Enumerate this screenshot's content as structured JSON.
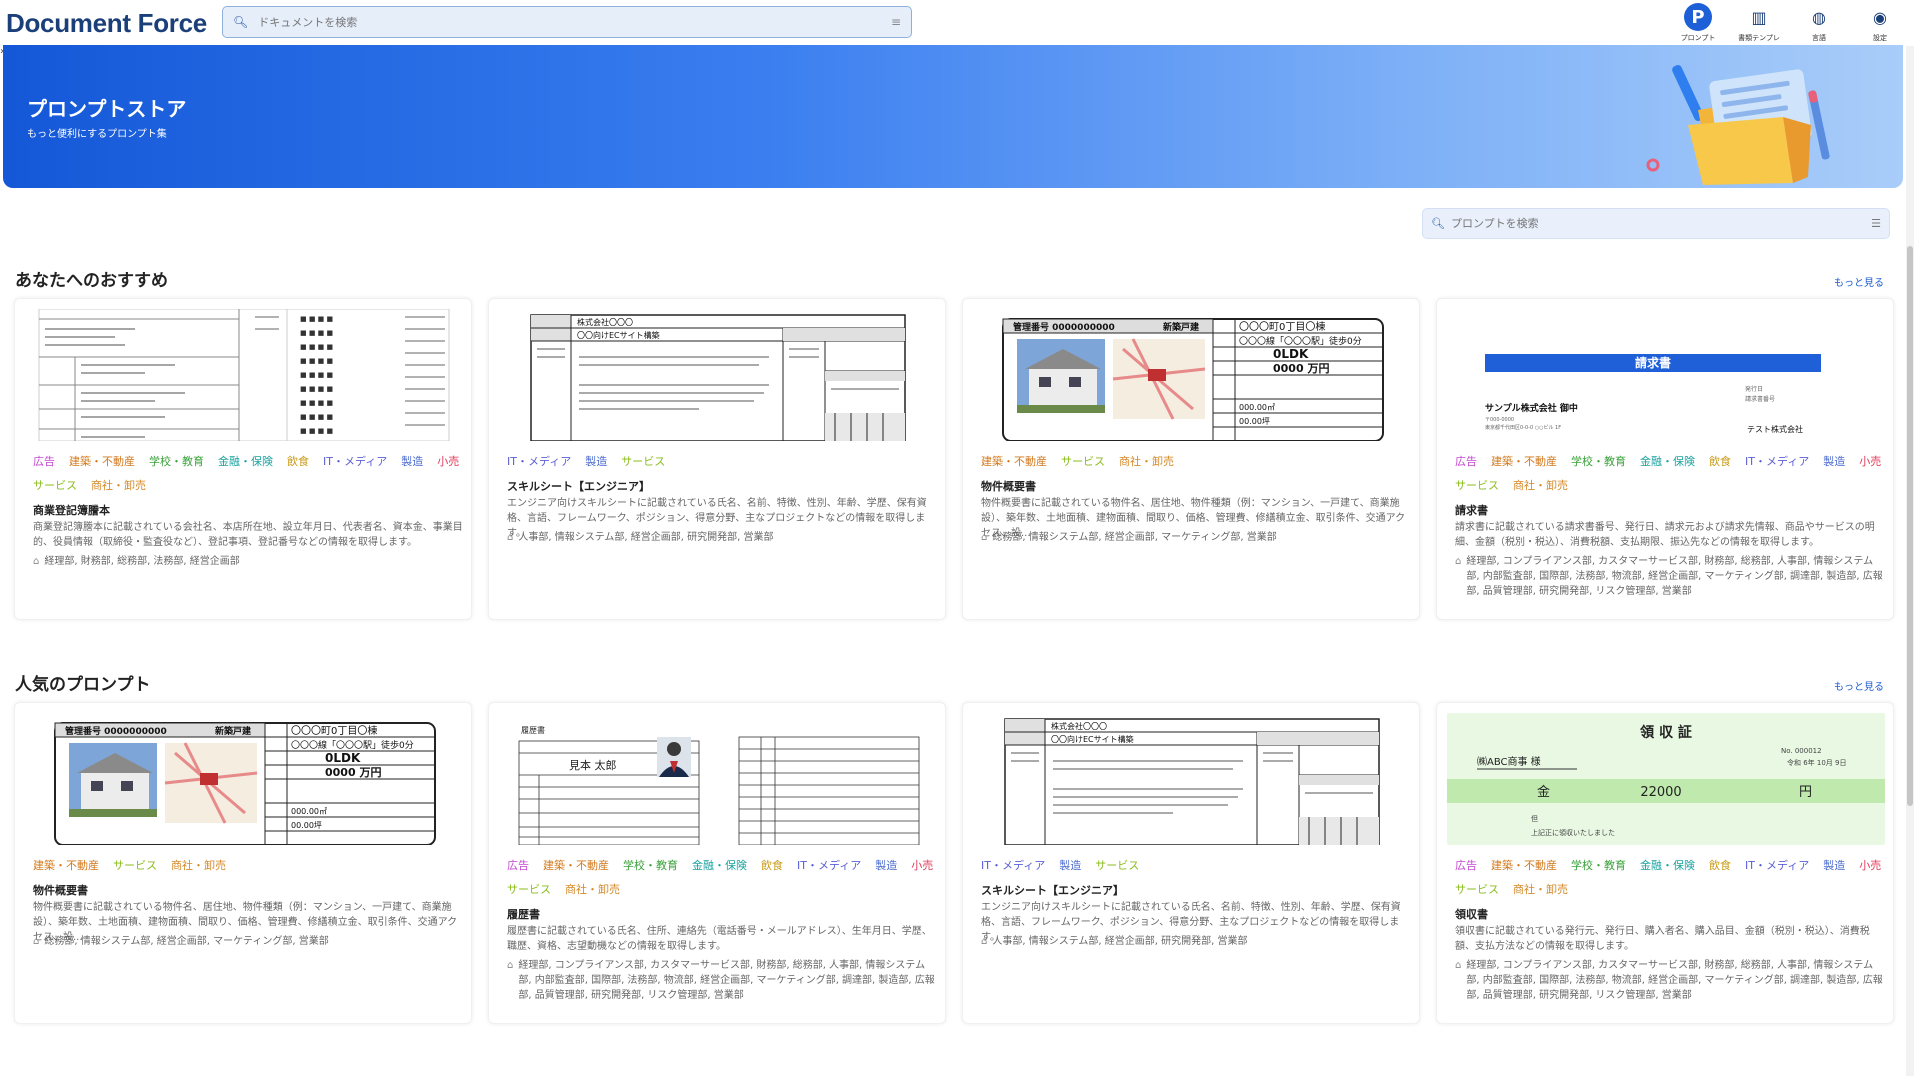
{
  "app": {
    "logo": "Document Force"
  },
  "header": {
    "search_placeholder": "ドキュメントを検索",
    "nav": [
      {
        "label": "プロンプト",
        "icon": "prompt-icon",
        "glyph": "P"
      },
      {
        "label": "書類テンプレ",
        "icon": "template-icon",
        "glyph": "▥"
      },
      {
        "label": "言語",
        "icon": "globe-icon",
        "glyph": "◍"
      },
      {
        "label": "設定",
        "icon": "user-settings-icon",
        "glyph": "◉"
      }
    ]
  },
  "banner": {
    "title": "プロンプトストア",
    "subtitle": "もっと便利にするプロンプト集"
  },
  "prompt_search": {
    "placeholder": "プロンプトを検索"
  },
  "sections": [
    {
      "title": "あなたへのおすすめ",
      "more": "もっと見る",
      "cards": [
        {
          "tags": [
            [
              "広告",
              "ad"
            ],
            [
              "建築・不動産",
              "re"
            ],
            [
              "学校・教育",
              "ed"
            ],
            [
              "金融・保険",
              "fi"
            ],
            [
              "飲食",
              "fd"
            ],
            [
              "IT・メディア",
              "it"
            ],
            [
              "製造",
              "mf"
            ],
            [
              "小売",
              "rt"
            ],
            [
              "サービス",
              "sv"
            ],
            [
              "商社・卸売",
              "tr"
            ]
          ],
          "title": "商業登記簿謄本",
          "desc": "商業登記簿謄本に記載されている会社名、本店所在地、設立年月日、代表者名、資本金、事業目的、役員情報（取締役・監査役など）、登記事項、登記番号などの情報を取得します。",
          "depts": "経理部, 財務部, 総務部, 法務部, 経営企画部"
        },
        {
          "tags": [
            [
              "IT・メディア",
              "it"
            ],
            [
              "製造",
              "mf"
            ],
            [
              "サービス",
              "sv"
            ]
          ],
          "title": "スキルシート【エンジニア】",
          "desc": "エンジニア向けスキルシートに記載されている氏名、名前、特徴、性別、年齢、学歴、保有資格、言語、フレームワーク、ポジション、得意分野、主なプロジェクトなどの情報を取得します。",
          "depts": "人事部, 情報システム部, 経営企画部, 研究開発部, 営業部"
        },
        {
          "tags": [
            [
              "建築・不動産",
              "re"
            ],
            [
              "サービス",
              "sv"
            ],
            [
              "商社・卸売",
              "tr"
            ]
          ],
          "title": "物件概要書",
          "desc": "物件概要書に記載されている物件名、居住地、物件種類（例：マンション、一戸建て、商業施設）、築年数、土地面積、建物面積、間取り、価格、管理費、修繕積立金、取引条件、交通アクセス、設...",
          "depts": "総務部, 情報システム部, 経営企画部, マーケティング部, 営業部"
        },
        {
          "tags": [
            [
              "広告",
              "ad"
            ],
            [
              "建築・不動産",
              "re"
            ],
            [
              "学校・教育",
              "ed"
            ],
            [
              "金融・保険",
              "fi"
            ],
            [
              "飲食",
              "fd"
            ],
            [
              "IT・メディア",
              "it"
            ],
            [
              "製造",
              "mf"
            ],
            [
              "小売",
              "rt"
            ],
            [
              "サービス",
              "sv"
            ],
            [
              "商社・卸売",
              "tr"
            ]
          ],
          "title": "請求書",
          "desc": "請求書に記載されている請求書番号、発行日、請求元および請求先情報、商品やサービスの明細、金額（税別・税込）、消費税額、支払期限、振込先などの情報を取得します。",
          "depts": "経理部, コンプライアンス部, カスタマーサービス部, 財務部, 総務部, 人事部, 情報システム部, 内部監査部, 国際部, 法務部, 物流部, 経営企画部, マーケティング部, 調達部, 製造部, 広報部, 品質管理部, 研究開発部, リスク管理部, 営業部"
        }
      ]
    },
    {
      "title": "人気のプロンプト",
      "more": "もっと見る",
      "cards": [
        {
          "tags": [
            [
              "建築・不動産",
              "re"
            ],
            [
              "サービス",
              "sv"
            ],
            [
              "商社・卸売",
              "tr"
            ]
          ],
          "title": "物件概要書",
          "desc": "物件概要書に記載されている物件名、居住地、物件種類（例：マンション、一戸建て、商業施設）、築年数、土地面積、建物面積、間取り、価格、管理費、修繕積立金、取引条件、交通アクセス、設...",
          "depts": "総務部, 情報システム部, 経営企画部, マーケティング部, 営業部"
        },
        {
          "tags": [
            [
              "広告",
              "ad"
            ],
            [
              "建築・不動産",
              "re"
            ],
            [
              "学校・教育",
              "ed"
            ],
            [
              "金融・保険",
              "fi"
            ],
            [
              "飲食",
              "fd"
            ],
            [
              "IT・メディア",
              "it"
            ],
            [
              "製造",
              "mf"
            ],
            [
              "小売",
              "rt"
            ],
            [
              "サービス",
              "sv"
            ],
            [
              "商社・卸売",
              "tr"
            ]
          ],
          "title": "履歴書",
          "desc": "履歴書に記載されている氏名、住所、連絡先（電話番号・メールアドレス）、生年月日、学歴、職歴、資格、志望動機などの情報を取得します。",
          "depts": "経理部, コンプライアンス部, カスタマーサービス部, 財務部, 総務部, 人事部, 情報システム部, 内部監査部, 国際部, 法務部, 物流部, 経営企画部, マーケティング部, 調達部, 製造部, 広報部, 品質管理部, 研究開発部, リスク管理部, 営業部"
        },
        {
          "tags": [
            [
              "IT・メディア",
              "it"
            ],
            [
              "製造",
              "mf"
            ],
            [
              "サービス",
              "sv"
            ]
          ],
          "title": "スキルシート【エンジニア】",
          "desc": "エンジニア向けスキルシートに記載されている氏名、名前、特徴、性別、年齢、学歴、保有資格、言語、フレームワーク、ポジション、得意分野、主なプロジェクトなどの情報を取得します。",
          "depts": "人事部, 情報システム部, 経営企画部, 研究開発部, 営業部"
        },
        {
          "tags": [
            [
              "広告",
              "ad"
            ],
            [
              "建築・不動産",
              "re"
            ],
            [
              "学校・教育",
              "ed"
            ],
            [
              "金融・保険",
              "fi"
            ],
            [
              "飲食",
              "fd"
            ],
            [
              "IT・メディア",
              "it"
            ],
            [
              "製造",
              "mf"
            ],
            [
              "小売",
              "rt"
            ],
            [
              "サービス",
              "sv"
            ],
            [
              "商社・卸売",
              "tr"
            ]
          ],
          "title": "領収書",
          "desc": "領収書に記載されている発行元、発行日、購入者名、購入品目、金額（税別・税込）、消費税額、支払方法などの情報を取得します。",
          "depts": "経理部, コンプライアンス部, カスタマーサービス部, 財務部, 総務部, 人事部, 情報システム部, 内部監査部, 国際部, 法務部, 物流部, 経営企画部, マーケティング部, 調達部, 製造部, 広報部, 品質管理部, 研究開発部, リスク管理部, 営業部"
        }
      ]
    }
  ],
  "thumbs": {
    "property": {
      "id_label": "管理番号",
      "id_value": "0000000000",
      "type": "新築戸建",
      "addr": "〇〇〇町0丁目〇棟",
      "station": "〇〇〇線「〇〇〇駅」徒歩0分",
      "layout": "0LDK",
      "price": "0000",
      "price_unit": "万円",
      "area1": "000.00㎡",
      "area2": "00.00坪"
    },
    "skill": {
      "company": "株式会社〇〇〇",
      "project": "〇〇向けECサイト構築"
    },
    "invoice": {
      "title": "請求書",
      "to": "サンプル株式会社 御中",
      "from": "テスト株式会社"
    },
    "resume": {
      "heading": "履歴書",
      "name": "見本 太郎"
    },
    "receipt": {
      "title": "領 収 証",
      "no": "No. 000012",
      "date": "令和 6年 10月 9日",
      "to": "㈱ABC商事 様",
      "kin": "金",
      "amount": "22000",
      "yen": "円",
      "note": "上記正に領収いたしました"
    }
  }
}
